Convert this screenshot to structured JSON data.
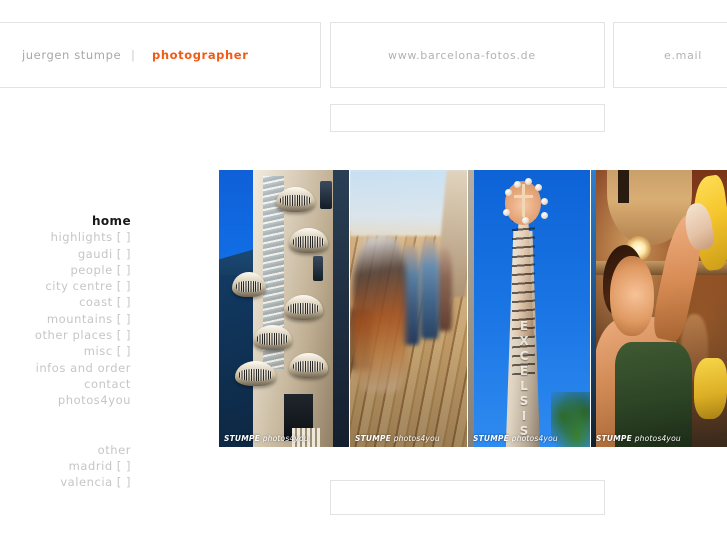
{
  "header": {
    "brand_name": "juergen stumpe",
    "brand_separator": "|",
    "brand_role": "photographer",
    "site_url": "www.barcelona-fotos.de",
    "email_label": "e.mail"
  },
  "nav": {
    "items": [
      {
        "label": "home",
        "brackets": "",
        "active": true
      },
      {
        "label": "highlights",
        "brackets": "[ ]",
        "active": false
      },
      {
        "label": "gaudi",
        "brackets": "[ ]",
        "active": false
      },
      {
        "label": "people",
        "brackets": "[ ]",
        "active": false
      },
      {
        "label": "city centre",
        "brackets": "[ ]",
        "active": false
      },
      {
        "label": "coast",
        "brackets": "[ ]",
        "active": false
      },
      {
        "label": "mountains",
        "brackets": "[ ]",
        "active": false
      },
      {
        "label": "other places",
        "brackets": "[ ]",
        "active": false
      },
      {
        "label": "misc",
        "brackets": "[ ]",
        "active": false
      },
      {
        "label": "infos and order",
        "brackets": "",
        "active": false
      },
      {
        "label": "contact",
        "brackets": "",
        "active": false
      },
      {
        "label": "photos4you",
        "brackets": "",
        "active": false
      }
    ],
    "secondary": [
      {
        "label": "other",
        "brackets": ""
      },
      {
        "label": "madrid",
        "brackets": "[ ]"
      },
      {
        "label": "valencia",
        "brackets": "[ ]"
      }
    ]
  },
  "gallery": {
    "watermark_brand": "STUMPE",
    "watermark_suffix": "photos4you",
    "spire_inscription": "EXCELSIS",
    "photos": [
      {
        "name": "gaudi-facade",
        "caption": "STUMPE photos4you"
      },
      {
        "name": "boardwalk-people",
        "caption": "STUMPE photos4you"
      },
      {
        "name": "sagrada-familia-spire",
        "caption": "STUMPE photos4you"
      },
      {
        "name": "market-vendor",
        "caption": "STUMPE photos4you"
      }
    ]
  },
  "colors": {
    "accent_orange": "#f15a16",
    "nav_grey": "#c6c6c6",
    "nav_active": "#181818",
    "box_border": "#e3e3e3",
    "sky_blue": "#1272e8"
  }
}
